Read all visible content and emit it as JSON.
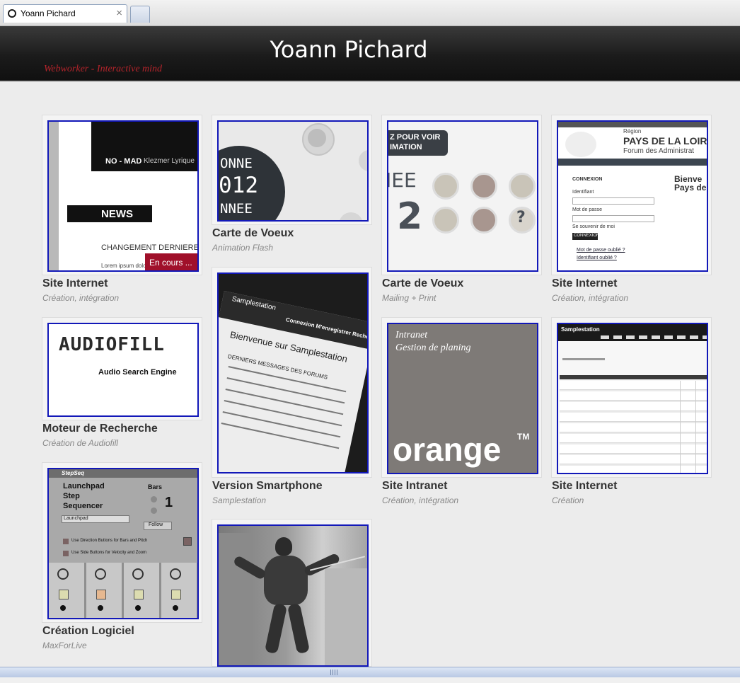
{
  "browser": {
    "tab_title": "Yoann Pichard",
    "tab_close": "×"
  },
  "header": {
    "title": "Yoann Pichard",
    "tagline": "Webworker - Interactive mind"
  },
  "cards": [
    {
      "title": "Site Internet",
      "subtitle": "Création, intégration",
      "thumb": {
        "label1": "NO - MAD",
        "label2": "Klezmer Lyrique",
        "news": "NEWS",
        "headline": "CHANGEMENT DERNIERE MIN",
        "lorem": "Lorem ipsum dolor",
        "badge": "En cours ..."
      }
    },
    {
      "title": "Carte de Voeux",
      "subtitle": "Animation Flash",
      "thumb": {
        "line1": "ONNE",
        "line2": "012",
        "line3": "NNEE"
      }
    },
    {
      "title": "Carte de Voeux",
      "subtitle": "Mailing + Print",
      "thumb": {
        "banner1": "Z POUR VOIR",
        "banner2": "IMATION",
        "big1": "IEE",
        "big2": "2",
        "q": "?"
      }
    },
    {
      "title": "Site Internet",
      "subtitle": "Création, intégration",
      "thumb": {
        "region": "Région",
        "name": "PAYS DE LA LOIRE",
        "forum": "Forum des Administrat",
        "connexion": "CONNEXION",
        "ident": "Identifiant",
        "pass": "Mot de passe",
        "remember": "Se souvenir de moi",
        "btn": "CONNEXION",
        "forgot": "Mot de passe oublié ?",
        "forgot2": "Identifiant oublié ?",
        "welcome1": "Bienve",
        "welcome2": "Pays de"
      }
    },
    {
      "title": "Moteur de Recherche",
      "subtitle": "Création de Audiofill",
      "thumb": {
        "logo": "AUDIOFILL",
        "tag": "Audio Search Engine"
      }
    },
    {
      "title": "Version Smartphone",
      "subtitle": "Samplestation",
      "thumb": {
        "brand": "Samplestation",
        "menu": "Connexion M'enregistrer Rechercher",
        "welcome": "Bienvenue sur Samplestation",
        "msg": "DERNIERS MESSAGES DES FORUMS"
      }
    },
    {
      "title": "Site Intranet",
      "subtitle": "Création, intégration",
      "thumb": {
        "line1": "Intranet",
        "line2": "Gestion de planing",
        "brand": "orange",
        "tm": "TM"
      }
    },
    {
      "title": "Site Internet",
      "subtitle": "Création",
      "thumb": {
        "brand": "Samplestation"
      }
    },
    {
      "title": "Création Logiciel",
      "subtitle": "MaxForLive",
      "thumb": {
        "app": "StepSeq",
        "l1": "Launchpad",
        "l2": "Step",
        "l3": "Sequencer",
        "bars": "Bars",
        "bars_val": "1",
        "device": "Launchpad",
        "follow": "Follow",
        "opt1": "Use Direction Buttons for Bars and Pitch",
        "opt2": "Use Side Buttons for Velocity and Zoom"
      }
    },
    {
      "title": "",
      "subtitle": "",
      "thumb": {}
    }
  ]
}
